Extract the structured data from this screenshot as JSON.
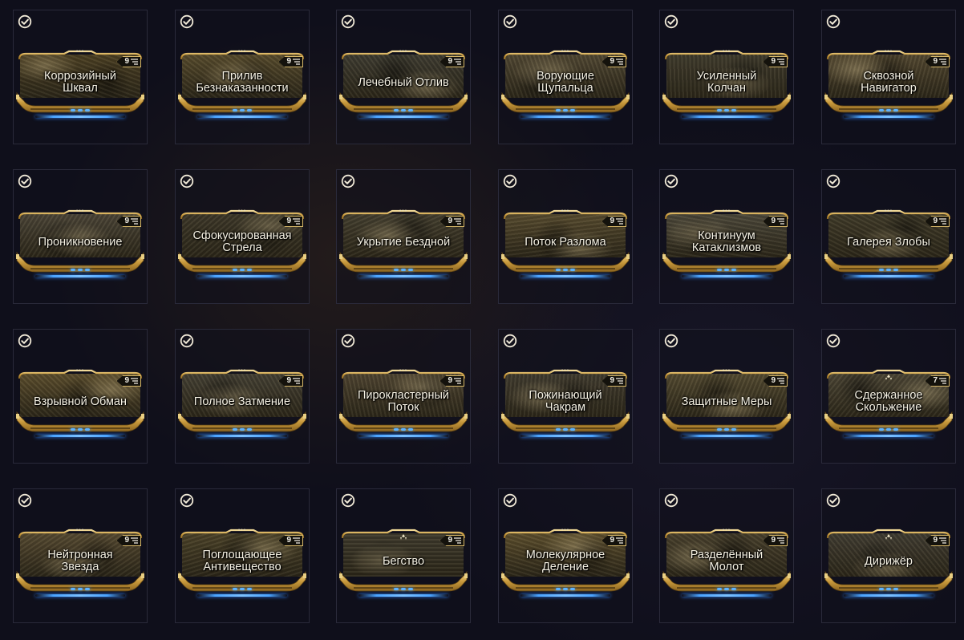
{
  "colors": {
    "background": "#0f0f1b",
    "gold_frame": "#d7b869",
    "name_text": "#f6f2e4",
    "capacity_blue": "#5fb3ff",
    "check_icon": "#f1ead8"
  },
  "mods": [
    {
      "name": "Коррозийный\nШквал",
      "drain": "9",
      "equipped": true,
      "drain_icon": "capacity-icon",
      "rank_marker": "dots",
      "tone": "#4a3e22"
    },
    {
      "name": "Прилив\nБезнаказанности",
      "drain": "9",
      "equipped": true,
      "drain_icon": "capacity-icon",
      "rank_marker": "dots",
      "tone": "#564a2c"
    },
    {
      "name": "Лечебный Отлив",
      "drain": "9",
      "equipped": true,
      "drain_icon": "capacity-icon",
      "rank_marker": "dots",
      "tone": "#3c3a30"
    },
    {
      "name": "Ворующие\nЩупальца",
      "drain": "9",
      "equipped": true,
      "drain_icon": "capacity-icon",
      "rank_marker": "dots",
      "tone": "#4f4632"
    },
    {
      "name": "Усиленный\nКолчан",
      "drain": "9",
      "equipped": true,
      "drain_icon": "capacity-icon",
      "rank_marker": "dots",
      "tone": "#3e3a2c"
    },
    {
      "name": "Сквозной\nНавигатор",
      "drain": "9",
      "equipped": true,
      "drain_icon": "capacity-icon",
      "rank_marker": "dots",
      "tone": "#524730"
    },
    {
      "name": "Проникновение",
      "drain": "9",
      "equipped": true,
      "drain_icon": "capacity-icon",
      "rank_marker": "dots",
      "tone": "#494336"
    },
    {
      "name": "Сфокусированная\nСтрела",
      "drain": "9",
      "equipped": true,
      "drain_icon": "capacity-icon",
      "rank_marker": "dots",
      "tone": "#3b3628"
    },
    {
      "name": "Укрытие Бездной",
      "drain": "9",
      "equipped": true,
      "drain_icon": "capacity-icon",
      "rank_marker": "dots",
      "tone": "#423d2e"
    },
    {
      "name": "Поток Разлома",
      "drain": "9",
      "equipped": true,
      "drain_icon": "capacity-icon",
      "rank_marker": "dots",
      "tone": "#564a2e"
    },
    {
      "name": "Континуум\nКатаклизмов",
      "drain": "9",
      "equipped": true,
      "drain_icon": "capacity-icon",
      "rank_marker": "dots",
      "tone": "#4a4639"
    },
    {
      "name": "Галерея Злобы",
      "drain": "9",
      "equipped": true,
      "drain_icon": "capacity-icon",
      "rank_marker": "dots",
      "tone": "#3e3928"
    },
    {
      "name": "Взрывной Обман",
      "drain": "9",
      "equipped": true,
      "drain_icon": "capacity-icon",
      "rank_marker": "dots",
      "tone": "#5a4c2c"
    },
    {
      "name": "Полное Затмение",
      "drain": "9",
      "equipped": true,
      "drain_icon": "capacity-icon",
      "rank_marker": "dots",
      "tone": "#433f33"
    },
    {
      "name": "Пирокластерный\nПоток",
      "drain": "9",
      "equipped": true,
      "drain_icon": "capacity-icon",
      "rank_marker": "dots",
      "tone": "#4d4330"
    },
    {
      "name": "Пожинающий\nЧакрам",
      "drain": "9",
      "equipped": true,
      "drain_icon": "capacity-icon",
      "rank_marker": "dots",
      "tone": "#3f3a2e"
    },
    {
      "name": "Защитные Меры",
      "drain": "9",
      "equipped": true,
      "drain_icon": "capacity-icon",
      "rank_marker": "dots",
      "tone": "#524930"
    },
    {
      "name": "Сдержанное\nСкольжение",
      "drain": "7",
      "equipped": true,
      "drain_icon": "capacity-icon",
      "rank_marker": "polarity-icon",
      "tone": "#4a4434"
    },
    {
      "name": "Нейтронная\nЗвезда",
      "drain": "9",
      "equipped": true,
      "drain_icon": "capacity-icon",
      "rank_marker": "dots",
      "tone": "#544830"
    },
    {
      "name": "Поглощающее\nАнтивещество",
      "drain": "9",
      "equipped": true,
      "drain_icon": "capacity-icon",
      "rank_marker": "dots",
      "tone": "#4a4128"
    },
    {
      "name": "Бегство",
      "drain": "9",
      "equipped": true,
      "drain_icon": "capacity-icon",
      "rank_marker": "polarity-icon",
      "tone": "#3d392c"
    },
    {
      "name": "Молекулярное\nДеление",
      "drain": "9",
      "equipped": true,
      "drain_icon": "capacity-icon",
      "rank_marker": "dots",
      "tone": "#5b4d2c"
    },
    {
      "name": "Разделённый\nМолот",
      "drain": "9",
      "equipped": true,
      "drain_icon": "capacity-icon",
      "rank_marker": "dots",
      "tone": "#473f2c"
    },
    {
      "name": "Дирижёр",
      "drain": "9",
      "equipped": true,
      "drain_icon": "capacity-icon",
      "rank_marker": "polarity-icon",
      "tone": "#3f3b31"
    }
  ]
}
